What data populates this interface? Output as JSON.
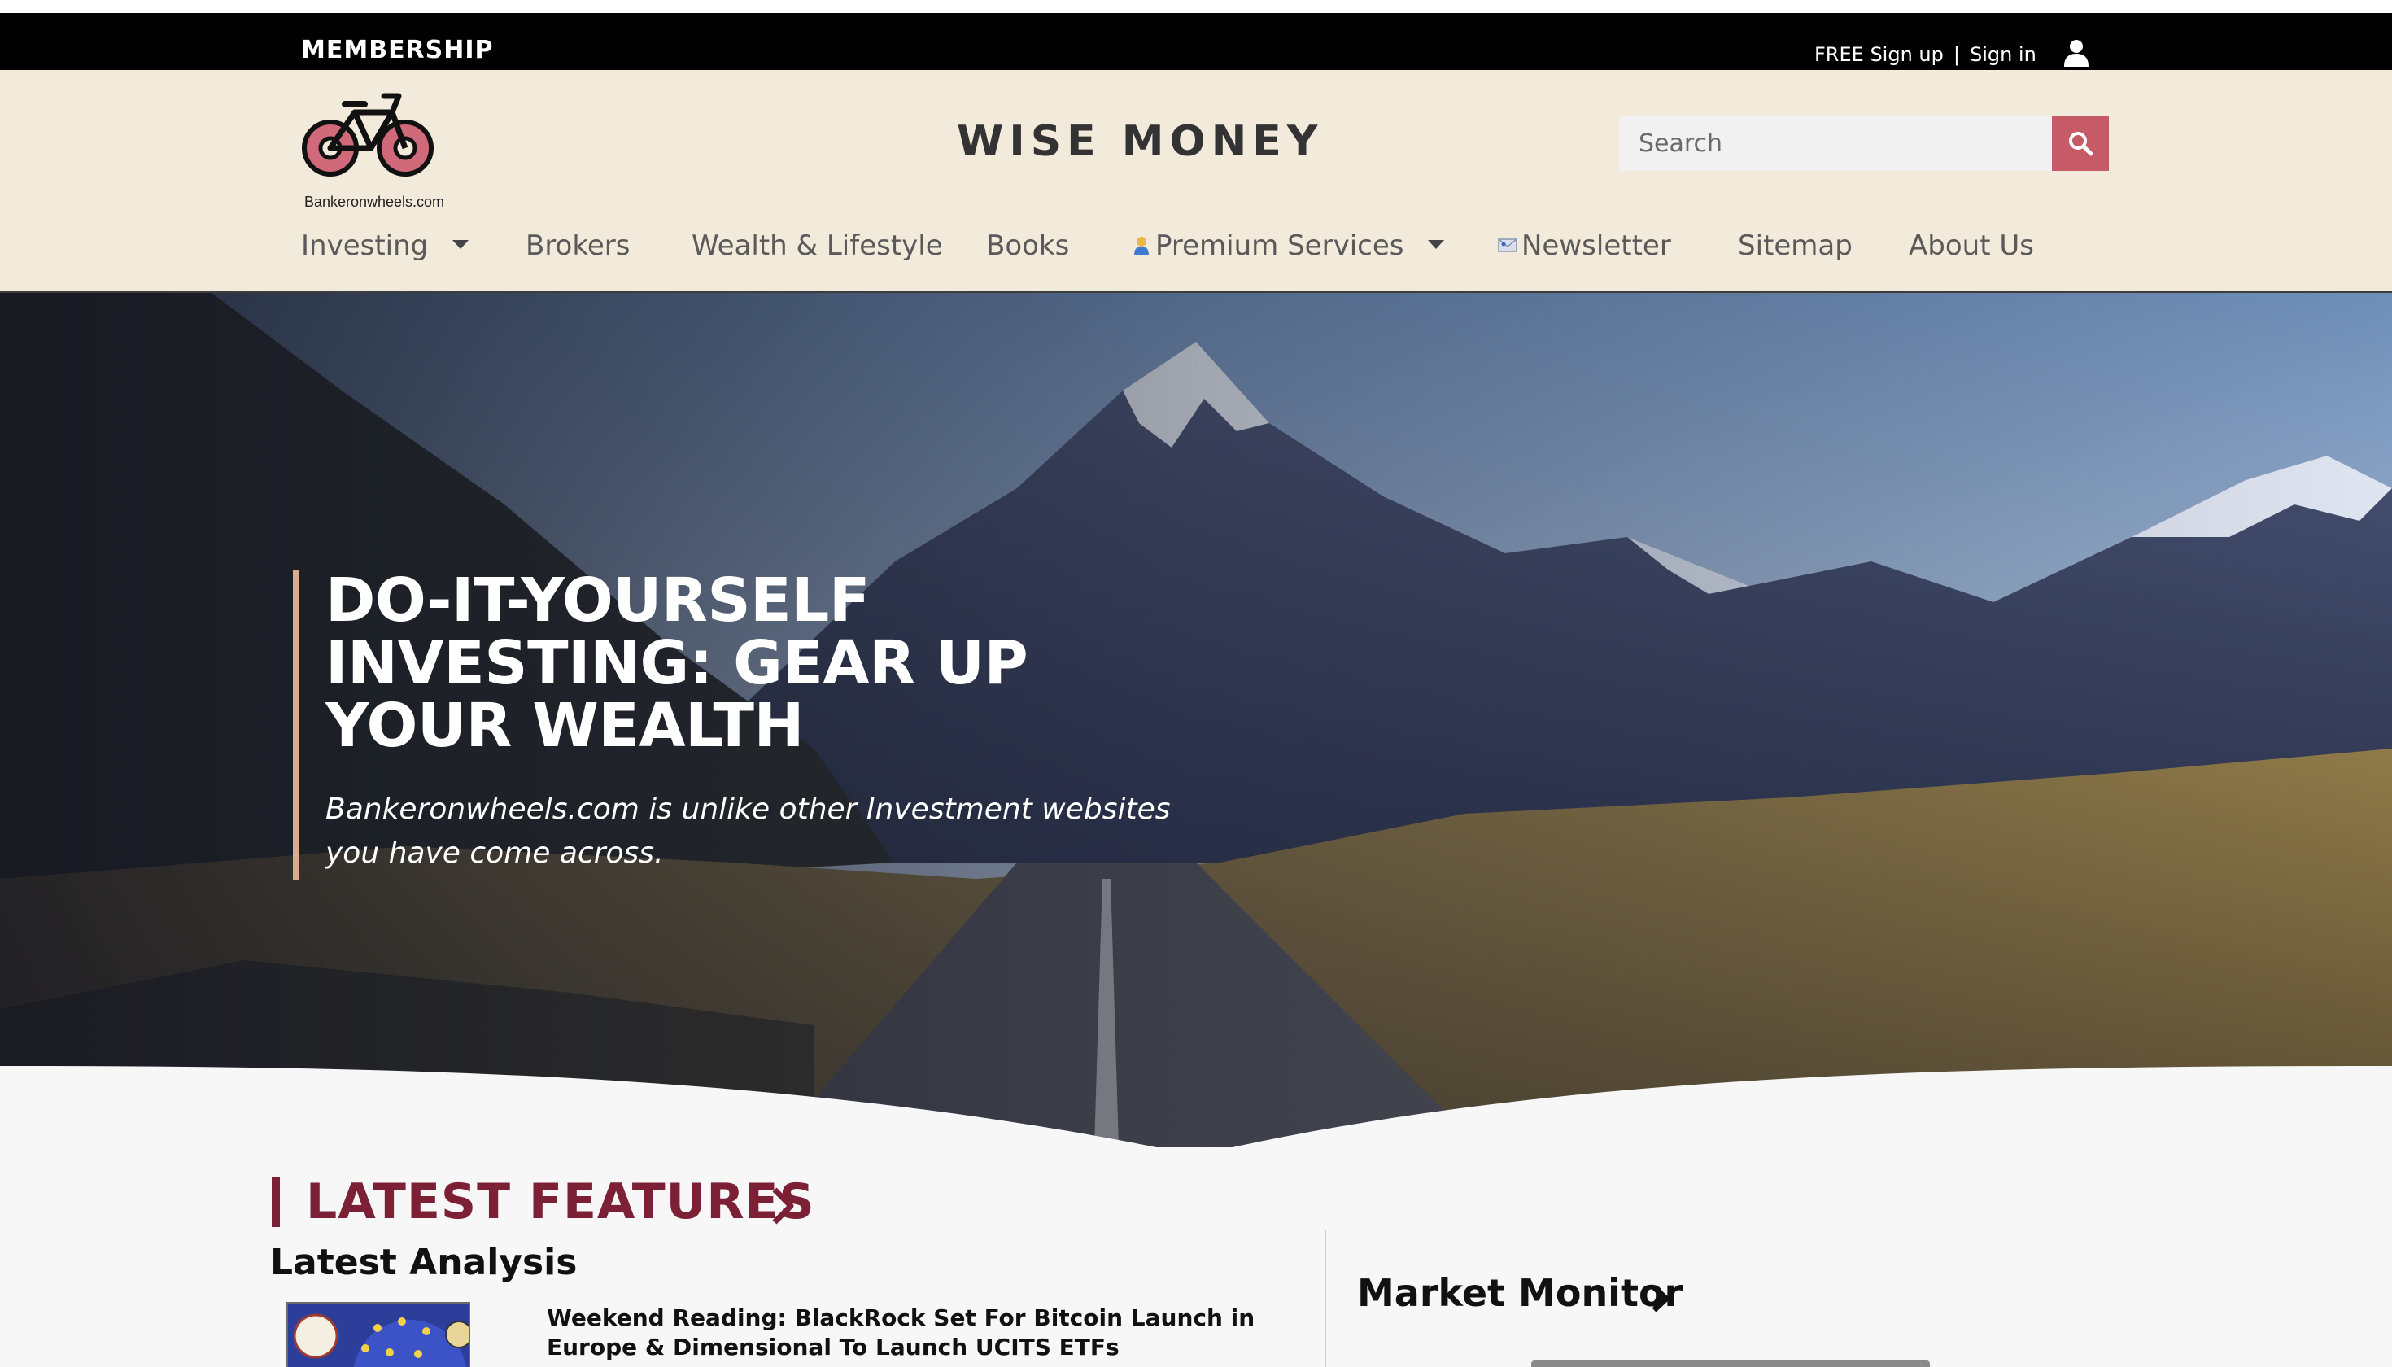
{
  "membership_bar": {
    "title": "MEMBERSHIP",
    "signup_label": "FREE Sign up",
    "separator": "|",
    "signin_label": "Sign in",
    "user_icon": "user-icon"
  },
  "header": {
    "logo_text": "Bankeronwheels.com",
    "site_title": "WISE MONEY",
    "search": {
      "placeholder": "Search",
      "button_icon": "search-icon"
    }
  },
  "nav": {
    "items": [
      {
        "label": "Investing",
        "has_dropdown": true
      },
      {
        "label": "Brokers"
      },
      {
        "label": "Wealth & Lifestyle"
      },
      {
        "label": "Books"
      },
      {
        "label": "Premium Services",
        "has_dropdown": true,
        "icon": "person-emoji-icon"
      },
      {
        "label": "Newsletter",
        "icon": "envelope-emoji-icon"
      },
      {
        "label": "Sitemap"
      },
      {
        "label": "About Us"
      }
    ]
  },
  "hero": {
    "title": "DO-IT-YOURSELF INVESTING: GEAR UP YOUR WEALTH",
    "subtitle": "Bankeronwheels.com is unlike other Investment websites you have come across."
  },
  "features": {
    "section_title": "LATEST FEATURES",
    "subsection_title": "Latest Analysis",
    "article_title": "Weekend Reading: BlackRock Set For Bitcoin Launch in Europe & Dimensional To Launch UCITS ETFs"
  },
  "sidebar": {
    "title": "Market Monitor"
  },
  "colors": {
    "accent": "#7b2035",
    "search_button": "#c65a67",
    "header_bg": "#f2eadb",
    "hero_accent": "#d9ab8f"
  }
}
